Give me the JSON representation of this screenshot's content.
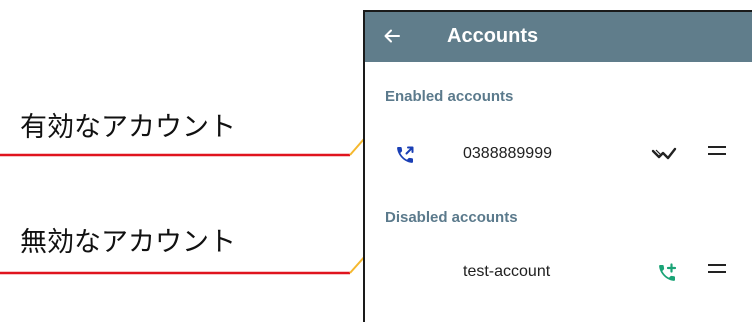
{
  "callouts": {
    "enabled_label": "有効なアカウント",
    "disabled_label": "無効なアカウント",
    "line_color": "#e0141e",
    "pointer_color": "#f5b82e"
  },
  "app": {
    "title": "Accounts",
    "appbar_color": "#607d8b"
  },
  "sections": {
    "enabled_header": "Enabled accounts",
    "disabled_header": "Disabled accounts"
  },
  "accounts": {
    "enabled": [
      {
        "name": "0388889999",
        "leading_icon": "call-made-icon",
        "status_icon": "signal-icon",
        "handle_icon": "drag-handle-icon"
      }
    ],
    "disabled": [
      {
        "name": "test-account",
        "status_icon": "add-call-icon",
        "handle_icon": "drag-handle-icon"
      }
    ]
  },
  "icons": {
    "back": "arrow-back-icon",
    "call_made_color": "#1a3fb5",
    "add_call_color": "#1aa376"
  }
}
